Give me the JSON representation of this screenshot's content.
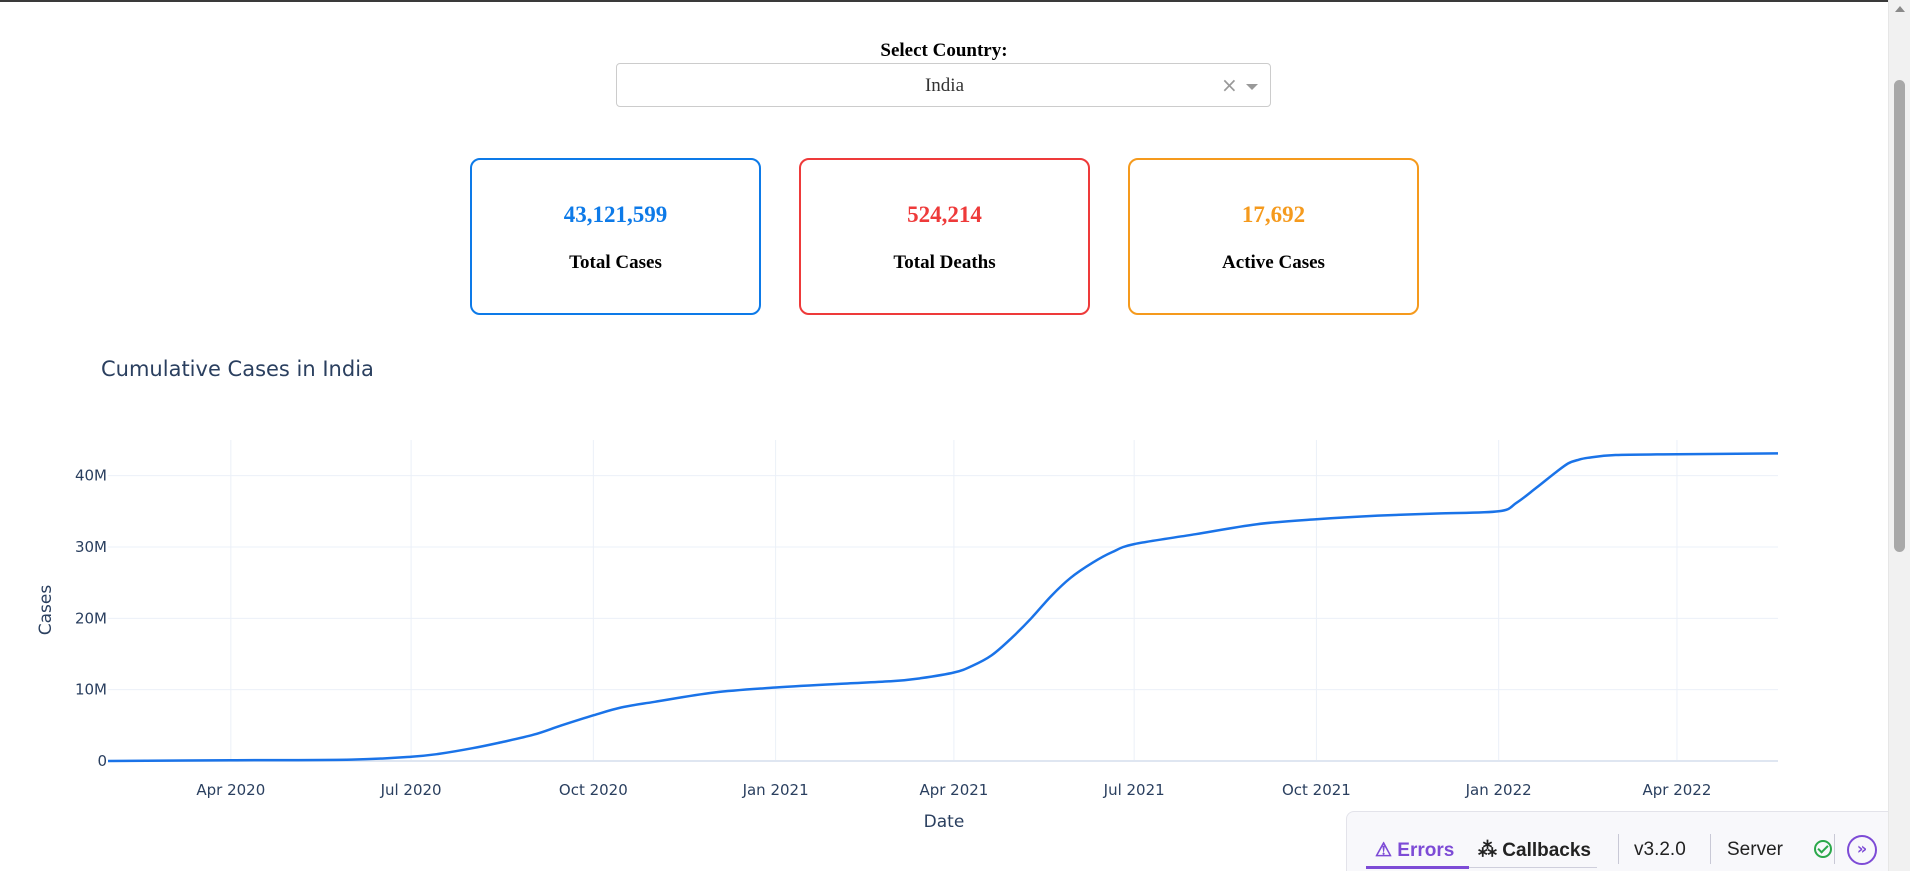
{
  "country_selector": {
    "label": "Select Country:",
    "selected": "India",
    "clear_icon": "×"
  },
  "cards": [
    {
      "value": "43,121,599",
      "label": "Total Cases",
      "color": "#0d7ae8"
    },
    {
      "value": "524,214",
      "label": "Total Deaths",
      "color": "#ee3a3a"
    },
    {
      "value": "17,692",
      "label": "Active Cases",
      "color": "#f59a1d"
    }
  ],
  "chart_data": {
    "type": "line",
    "title": "Cumulative Cases in India",
    "xlabel": "Date",
    "ylabel": "Cases",
    "line_color": "#1a73e8",
    "grid": true,
    "xlim": [
      "2020-01-30",
      "2022-05-22"
    ],
    "ylim": [
      0,
      45000000
    ],
    "x_ticks": [
      {
        "date": "2020-04-01",
        "label": "Apr 2020"
      },
      {
        "date": "2020-07-01",
        "label": "Jul 2020"
      },
      {
        "date": "2020-10-01",
        "label": "Oct 2020"
      },
      {
        "date": "2021-01-01",
        "label": "Jan 2021"
      },
      {
        "date": "2021-04-01",
        "label": "Apr 2021"
      },
      {
        "date": "2021-07-01",
        "label": "Jul 2021"
      },
      {
        "date": "2021-10-01",
        "label": "Oct 2021"
      },
      {
        "date": "2022-01-01",
        "label": "Jan 2022"
      },
      {
        "date": "2022-04-01",
        "label": "Apr 2022"
      }
    ],
    "y_ticks": [
      {
        "value": 0,
        "label": "0"
      },
      {
        "value": 10000000,
        "label": "10M"
      },
      {
        "value": 20000000,
        "label": "20M"
      },
      {
        "value": 30000000,
        "label": "30M"
      },
      {
        "value": 40000000,
        "label": "40M"
      }
    ],
    "x": [
      "2020-01-30",
      "2020-04-01",
      "2020-06-01",
      "2020-07-01",
      "2020-07-15",
      "2020-08-01",
      "2020-08-15",
      "2020-09-01",
      "2020-09-15",
      "2020-10-01",
      "2020-10-15",
      "2020-11-01",
      "2020-12-01",
      "2021-01-01",
      "2021-02-01",
      "2021-03-01",
      "2021-03-15",
      "2021-04-01",
      "2021-04-10",
      "2021-04-20",
      "2021-04-30",
      "2021-05-10",
      "2021-05-20",
      "2021-05-30",
      "2021-06-10",
      "2021-06-20",
      "2021-07-01",
      "2021-08-01",
      "2021-09-01",
      "2021-10-01",
      "2021-11-01",
      "2021-12-01",
      "2022-01-01",
      "2022-01-10",
      "2022-01-20",
      "2022-01-30",
      "2022-02-05",
      "2022-02-10",
      "2022-02-15",
      "2022-03-01",
      "2022-04-01",
      "2022-05-22"
    ],
    "y": [
      0,
      100000,
      200000,
      600000,
      1000000,
      1800000,
      2600000,
      3700000,
      5000000,
      6400000,
      7500000,
      8300000,
      9600000,
      10300000,
      10800000,
      11200000,
      11600000,
      12400000,
      13300000,
      14800000,
      17200000,
      20000000,
      23100000,
      25700000,
      27800000,
      29300000,
      30400000,
      31800000,
      33200000,
      33900000,
      34400000,
      34700000,
      35000000,
      36200000,
      38300000,
      40500000,
      41700000,
      42200000,
      42500000,
      42900000,
      43000000,
      43121599
    ]
  },
  "devtools": {
    "errors": "⚠ Errors",
    "callbacks": "⁂ Callbacks",
    "version": "v3.2.0",
    "server": "Server",
    "toggle": "»"
  }
}
